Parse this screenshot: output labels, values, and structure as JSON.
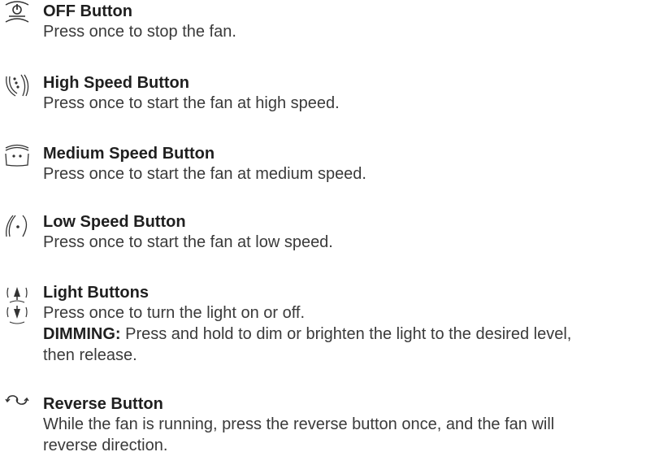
{
  "items": [
    {
      "icon": "power-icon",
      "title": "OFF Button",
      "lines": [
        "Press once to stop the fan."
      ]
    },
    {
      "icon": "high-speed-icon",
      "title": "High Speed Button",
      "lines": [
        "Press once to start the fan at high speed."
      ]
    },
    {
      "icon": "medium-speed-icon",
      "title": "Medium Speed Button",
      "lines": [
        "Press once to start the fan at medium speed."
      ]
    },
    {
      "icon": "low-speed-icon",
      "title": "Low Speed Button",
      "lines": [
        "Press once to start the fan at low speed."
      ]
    },
    {
      "icon": "light-icon",
      "title": "Light Buttons",
      "lines": [
        "Press once to turn the light on or off."
      ],
      "dimming_label": "DIMMING:",
      "dimming_text": "Press and hold to dim or brighten the light to the desired level,",
      "dimming_text_2": "then release."
    },
    {
      "icon": "reverse-icon",
      "title": "Reverse Button",
      "lines": [
        "While the fan is running, press the reverse button once, and the fan will",
        "reverse direction."
      ]
    }
  ]
}
